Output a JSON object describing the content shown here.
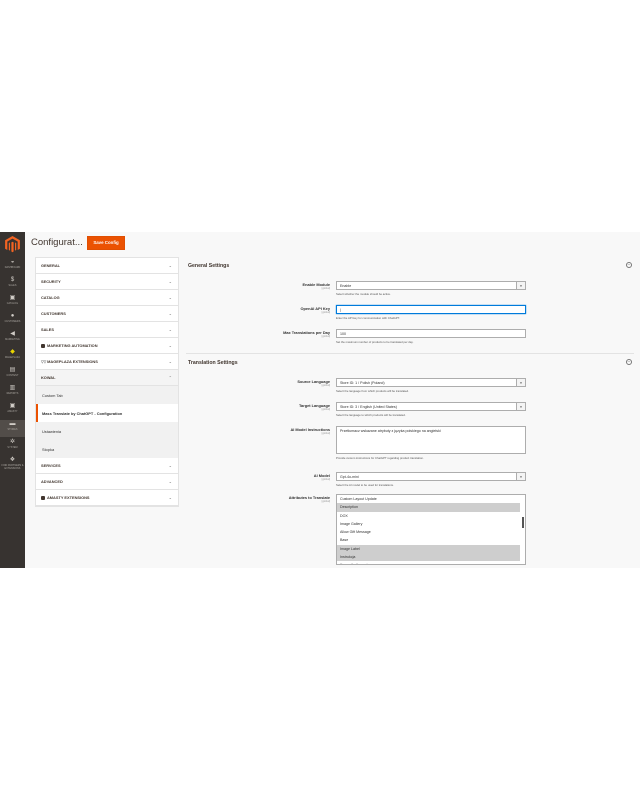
{
  "header": {
    "title": "Configurat...",
    "save_label": "Save Config"
  },
  "admin_menu": [
    {
      "label": "DASHBOARD",
      "icon": "dashboard-icon"
    },
    {
      "label": "SALES",
      "icon": "dollar-icon"
    },
    {
      "label": "CATALOG",
      "icon": "box-icon"
    },
    {
      "label": "CUSTOMERS",
      "icon": "person-icon"
    },
    {
      "label": "MARKETING",
      "icon": "megaphone-icon"
    },
    {
      "label": "MAGEPLAZA",
      "icon": "diamond-icon"
    },
    {
      "label": "CONTENT",
      "icon": "layout-icon"
    },
    {
      "label": "REPORTS",
      "icon": "bar-chart-icon"
    },
    {
      "label": "AMASTY",
      "icon": "amasty-icon"
    },
    {
      "label": "STORES",
      "icon": "store-icon"
    },
    {
      "label": "SYSTEM",
      "icon": "gear-icon"
    },
    {
      "label": "FIND PARTNERS & EXTENSIONS",
      "icon": "cubes-icon"
    }
  ],
  "tabs": {
    "general": "GENERAL",
    "security": "SECURITY",
    "catalog": "CATALOG",
    "customers": "CUSTOMERS",
    "sales": "SALES",
    "marketing_automation": "MARKETING AUTOMATION",
    "mageplaza_extensions": "MAGEPLAZA EXTENSIONS",
    "kowal": "KOWAL",
    "kowal_items": [
      "Custom Tab",
      "Mass Translate by ChatGPT - Configuration",
      "Ustawienia",
      "Stopka"
    ],
    "services": "SERVICES",
    "advanced": "ADVANCED",
    "amasty_extensions": "AMASTY EXTENSIONS"
  },
  "general_settings": {
    "title": "General Settings",
    "enable_module": {
      "label": "Enable Module",
      "scope": "[global]",
      "value": "Enable",
      "note": "Select whether the module should be active."
    },
    "api_key": {
      "label": "OpenAI API Key",
      "scope": "[global]",
      "value": "|",
      "note": "Enter the API key for communication with ChatGPT."
    },
    "max_translations": {
      "label": "Max Translations per Day",
      "scope": "[global]",
      "value": "100",
      "note": "Set the maximum number of products to be translated per day."
    }
  },
  "translation_settings": {
    "title": "Translation Settings",
    "source_language": {
      "label": "Source Language",
      "scope": "[global]",
      "value": "Store ID: 1 / Polish (Poland)",
      "note": "Select the language from which products will be translated."
    },
    "target_language": {
      "label": "Target Language",
      "scope": "[global]",
      "value": "Store ID: 3 / English (United States)",
      "note": "Select the language to which products will be translated."
    },
    "ai_instructions": {
      "label": "AI Model Instructions",
      "scope": "[global]",
      "value": "Przetłumacz wskazane atrybuty z języka polskiego na angielski",
      "note": "Provide custom instructions for ChatGPT regarding product translation."
    },
    "ai_model": {
      "label": "AI Model",
      "scope": "[global]",
      "value": "Gpt-4o-mini",
      "note": "Select the AI model to be used for translations."
    },
    "attributes": {
      "label": "Attributes to Translate",
      "scope": "[global]",
      "options": [
        {
          "text": "Custom Layout Update",
          "selected": false
        },
        {
          "text": "Description",
          "selected": true
        },
        {
          "text": "DOX",
          "selected": false
        },
        {
          "text": "Image Gallery",
          "selected": false
        },
        {
          "text": "Allow Gift Message",
          "selected": false
        },
        {
          "text": "Base",
          "selected": false
        },
        {
          "text": "Image Label",
          "selected": true
        },
        {
          "text": "Instrukcja",
          "selected": true
        },
        {
          "text": "Komunikat/uwagi",
          "selected": false
        }
      ]
    }
  },
  "colors": {
    "accent": "#eb5202",
    "menu_bg": "#373330",
    "focus": "#007bdb"
  }
}
